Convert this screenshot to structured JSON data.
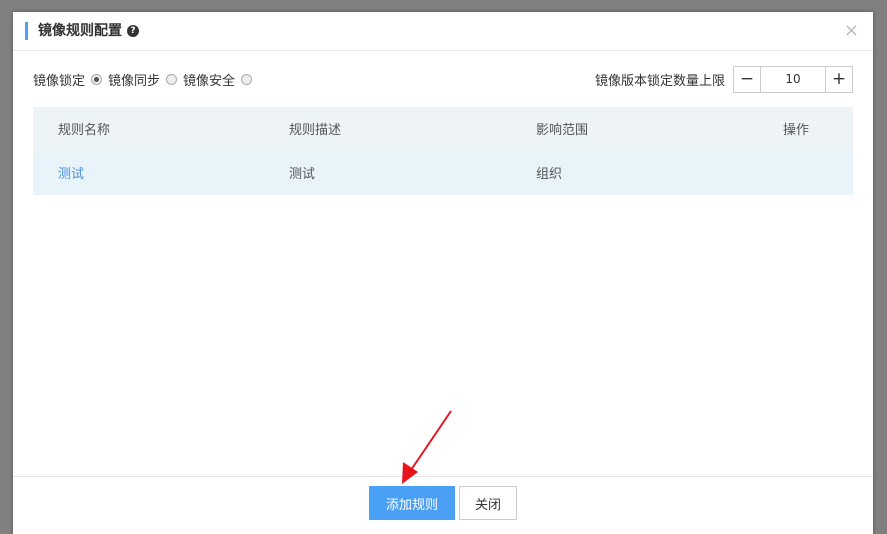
{
  "dialog": {
    "title": "镜像规则配置",
    "help_icon": "question-circle-icon",
    "close_icon": "close-icon",
    "close_glyph": "×"
  },
  "options": {
    "lock_label": "镜像锁定",
    "radios": [
      {
        "label": "镜像同步",
        "checked": true
      },
      {
        "label": "镜像安全",
        "checked": false
      }
    ],
    "limit_label": "镜像版本锁定数量上限",
    "limit_value": "10",
    "minus_glyph": "−",
    "plus_glyph": "+"
  },
  "table": {
    "columns": [
      "规则名称",
      "规则描述",
      "影响范围",
      "操作"
    ],
    "rows": [
      {
        "name": "测试",
        "description": "测试",
        "scope": "组织",
        "action": ""
      }
    ]
  },
  "footer": {
    "add_rule": "添加规则",
    "close": "关闭"
  },
  "colors": {
    "accent": "#4aa0f5",
    "link": "#4a90e2",
    "annotation_arrow": "#e8141c"
  }
}
